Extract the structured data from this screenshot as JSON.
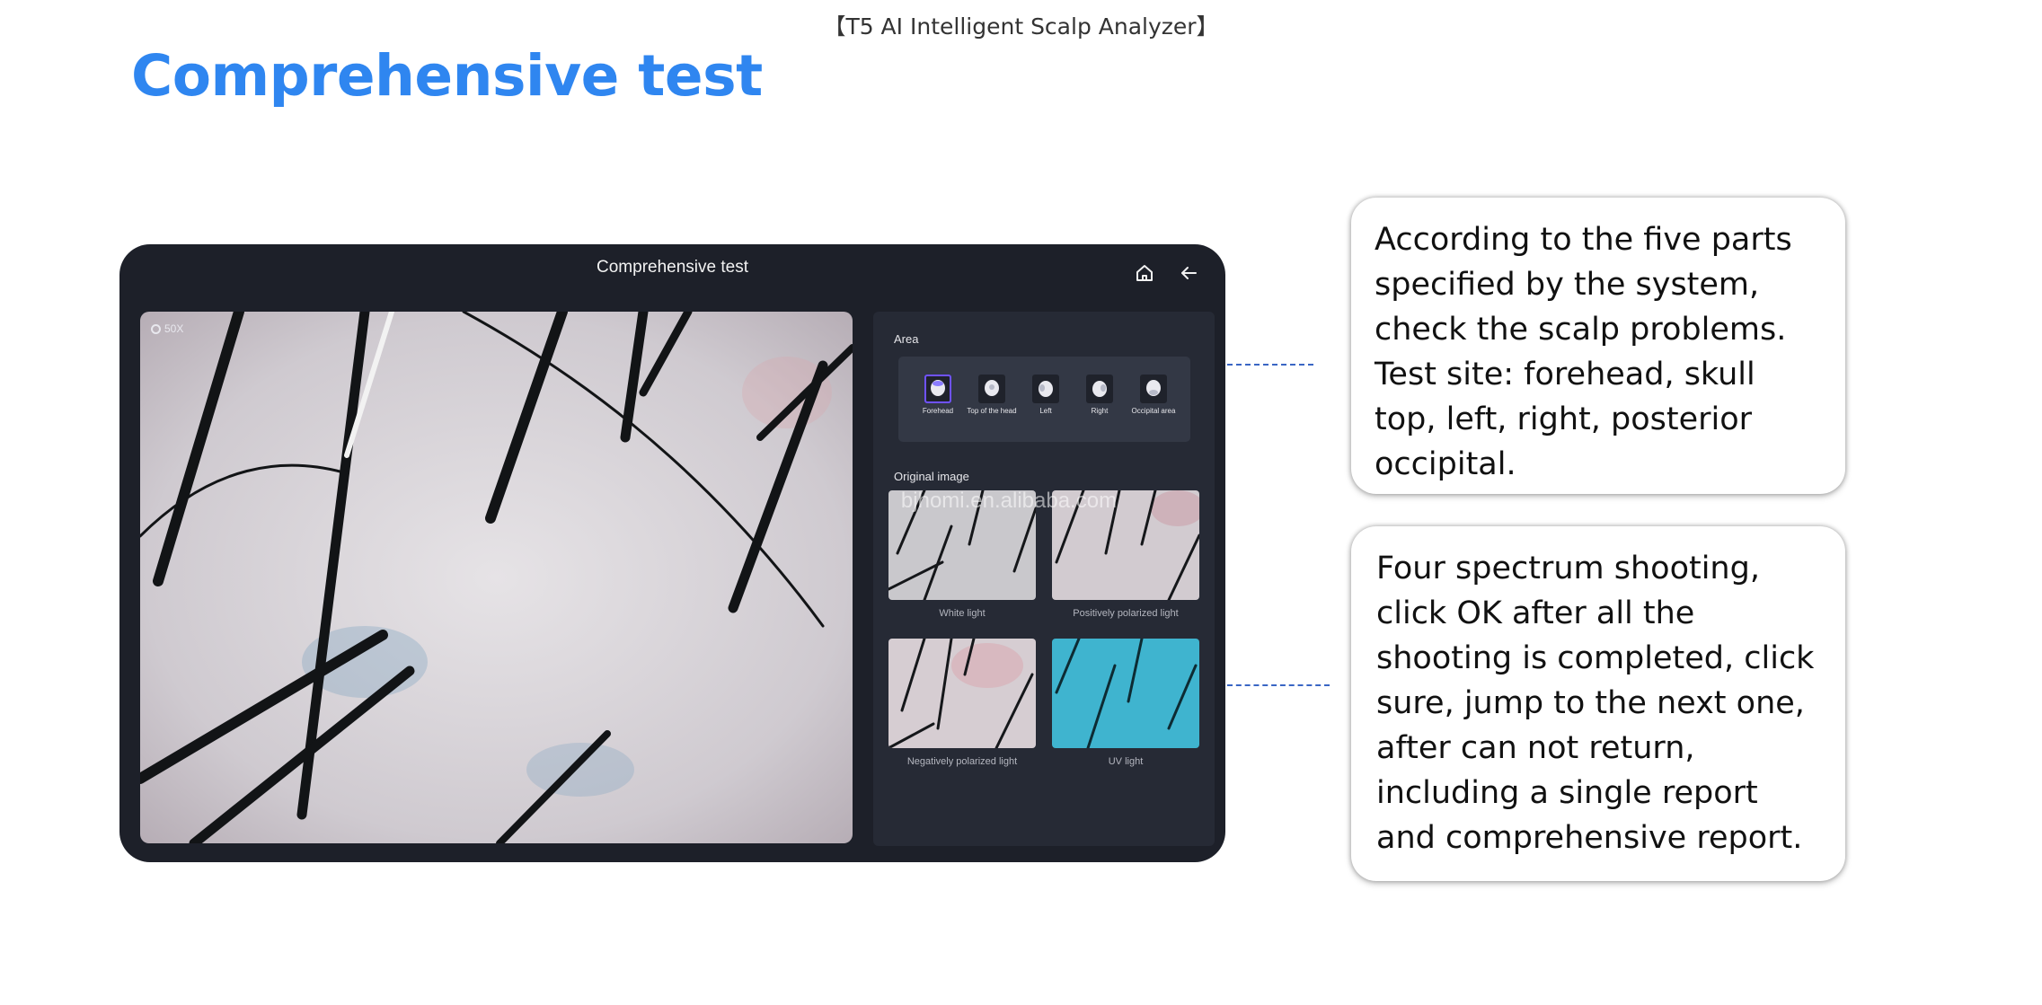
{
  "document": {
    "header": "【T5  AI Intelligent Scalp Analyzer】",
    "title": "Comprehensive test"
  },
  "tablet": {
    "title": "Comprehensive test",
    "home_icon": "home-icon",
    "back_icon": "arrow-left-icon",
    "zoom_level": "50X",
    "area_label": "Area",
    "areas": [
      {
        "label": "Forehead",
        "selected": true
      },
      {
        "label": "Top of the head",
        "selected": false
      },
      {
        "label": "Left",
        "selected": false
      },
      {
        "label": "Right",
        "selected": false
      },
      {
        "label": "Occipital area",
        "selected": false
      }
    ],
    "original_image_label": "Original image",
    "thumbnails": [
      {
        "caption": "White light"
      },
      {
        "caption": "Positively polarized light"
      },
      {
        "caption": "Negatively polarized light"
      },
      {
        "caption": "UV light"
      }
    ],
    "watermark": "bjhomi.en.alibaba.com"
  },
  "callouts": [
    {
      "text": "According to the five parts specified by the system, check the scalp problems. Test site: forehead, skull top, left, right, posterior occipital."
    },
    {
      "text": "Four spectrum shooting, click OK after all the shooting is completed, click sure, jump to the next one, after can not return, including a single report and comprehensive report."
    }
  ],
  "colors": {
    "title_blue": "#2f86f0",
    "tablet_bg": "#1d2029",
    "panel_bg": "#262a35",
    "selected_accent": "#6f52ff",
    "leader_line": "#3a66c4"
  }
}
